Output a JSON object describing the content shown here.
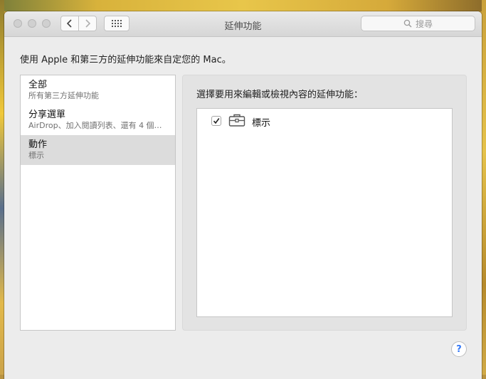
{
  "window": {
    "title": "延伸功能",
    "search_placeholder": "搜尋"
  },
  "intro_text": "使用 Apple 和第三方的延伸功能來自定您的 Mac。",
  "categories": [
    {
      "name": "全部",
      "desc": "所有第三方延伸功能",
      "selected": false
    },
    {
      "name": "分享選單",
      "desc": "AirDrop、加入閱讀列表、還有 4 個…",
      "selected": false
    },
    {
      "name": "動作",
      "desc": "標示",
      "selected": true
    }
  ],
  "detail": {
    "heading": "選擇要用來編輯或檢視內容的延伸功能：",
    "extensions": [
      {
        "label": "標示",
        "checked": true,
        "icon": "toolbox-icon"
      }
    ]
  },
  "help_label": "?"
}
